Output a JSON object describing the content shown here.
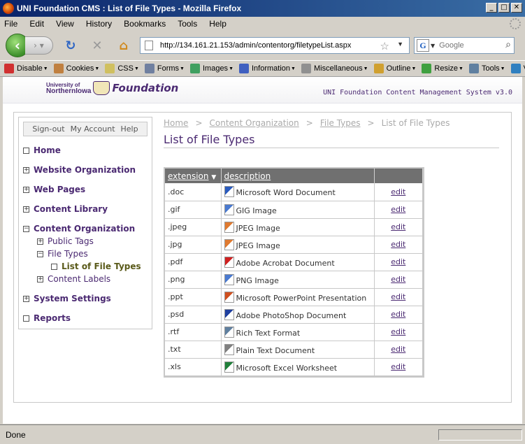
{
  "window": {
    "title": "UNI Foundation CMS : List of File Types - Mozilla Firefox"
  },
  "menu": [
    "File",
    "Edit",
    "View",
    "History",
    "Bookmarks",
    "Tools",
    "Help"
  ],
  "nav": {
    "url": "http://134.161.21.153/admin/contentorg/filetypeList.aspx",
    "search_placeholder": "Google"
  },
  "devbar": [
    {
      "label": "Disable",
      "icon": "disable-icon",
      "color": "#d03030"
    },
    {
      "label": "Cookies",
      "icon": "cookies-icon",
      "color": "#c08040"
    },
    {
      "label": "CSS",
      "icon": "css-icon",
      "color": "#d0c060"
    },
    {
      "label": "Forms",
      "icon": "forms-icon",
      "color": "#7080a0"
    },
    {
      "label": "Images",
      "icon": "images-icon",
      "color": "#40a060"
    },
    {
      "label": "Information",
      "icon": "information-icon",
      "color": "#4060c0"
    },
    {
      "label": "Miscellaneous",
      "icon": "miscellaneous-icon",
      "color": "#909090"
    },
    {
      "label": "Outline",
      "icon": "outline-icon",
      "color": "#d0a030"
    },
    {
      "label": "Resize",
      "icon": "resize-icon",
      "color": "#40a040"
    },
    {
      "label": "Tools",
      "icon": "tools-icon",
      "color": "#6080a0"
    },
    {
      "label": "Vie",
      "icon": "view-source-icon",
      "color": "#3080c0"
    }
  ],
  "site": {
    "logo_line1": "University of",
    "logo_line2": "NorthernIowa",
    "logo_foundation": "Foundation",
    "system_label": "UNI Foundation Content Management System v3.0"
  },
  "account": {
    "signout": "Sign-out",
    "myaccount": "My Account",
    "help": "Help"
  },
  "sidebar": [
    {
      "label": "Home",
      "box": "",
      "level": 0,
      "name": "home"
    },
    {
      "label": "Website Organization",
      "box": "+",
      "level": 0,
      "name": "website-organization"
    },
    {
      "label": "Web Pages",
      "box": "+",
      "level": 0,
      "name": "web-pages"
    },
    {
      "label": "Content Library",
      "box": "+",
      "level": 0,
      "name": "content-library"
    },
    {
      "label": "Content Organization",
      "box": "−",
      "level": 0,
      "name": "content-organization"
    },
    {
      "label": "Public Tags",
      "box": "+",
      "level": 1,
      "name": "public-tags"
    },
    {
      "label": "File Types",
      "box": "−",
      "level": 1,
      "name": "file-types"
    },
    {
      "label": "List of File Types",
      "box": "",
      "level": 2,
      "name": "list-of-file-types",
      "current": true
    },
    {
      "label": "Content Labels",
      "box": "+",
      "level": 1,
      "name": "content-labels"
    },
    {
      "label": "System Settings",
      "box": "+",
      "level": 0,
      "name": "system-settings"
    },
    {
      "label": "Reports",
      "box": "",
      "level": 0,
      "name": "reports"
    }
  ],
  "breadcrumb": {
    "home": "Home",
    "content_org": "Content Organization",
    "file_types": "File Types",
    "current": "List of File Types",
    "sep": ">"
  },
  "page_title": "List of File Types",
  "table": {
    "headers": {
      "extension": "extension",
      "sort_arrow": "▼",
      "description": "description"
    },
    "rows": [
      {
        "ext": ".doc",
        "desc": "Microsoft Word Document",
        "icon": "word-document-icon",
        "color": "#2a5bbf",
        "action": "edit"
      },
      {
        "ext": ".gif",
        "desc": "GIG Image",
        "icon": "gif-image-icon",
        "color": "#4a7ad0",
        "action": "edit"
      },
      {
        "ext": ".jpeg",
        "desc": "JPEG Image",
        "icon": "jpeg-image-icon",
        "color": "#e07a30",
        "action": "edit"
      },
      {
        "ext": ".jpg",
        "desc": "JPEG Image",
        "icon": "jpg-image-icon",
        "color": "#e07a30",
        "action": "edit"
      },
      {
        "ext": ".pdf",
        "desc": "Adobe Acrobat Document",
        "icon": "pdf-document-icon",
        "color": "#d02020",
        "action": "edit"
      },
      {
        "ext": ".png",
        "desc": "PNG Image",
        "icon": "png-image-icon",
        "color": "#4a7ad0",
        "action": "edit"
      },
      {
        "ext": ".ppt",
        "desc": "Microsoft PowerPoint Presentation",
        "icon": "powerpoint-icon",
        "color": "#d05020",
        "action": "edit"
      },
      {
        "ext": ".psd",
        "desc": "Adobe PhotoShop Document",
        "icon": "photoshop-icon",
        "color": "#2040a0",
        "action": "edit"
      },
      {
        "ext": ".rtf",
        "desc": "Rich Text Format",
        "icon": "rtf-document-icon",
        "color": "#6080a0",
        "action": "edit"
      },
      {
        "ext": ".txt",
        "desc": "Plain Text Document",
        "icon": "text-document-icon",
        "color": "#808080",
        "action": "edit"
      },
      {
        "ext": ".xls",
        "desc": "Microsoft Excel Worksheet",
        "icon": "excel-icon",
        "color": "#20803a",
        "action": "edit"
      }
    ]
  },
  "status": "Done"
}
